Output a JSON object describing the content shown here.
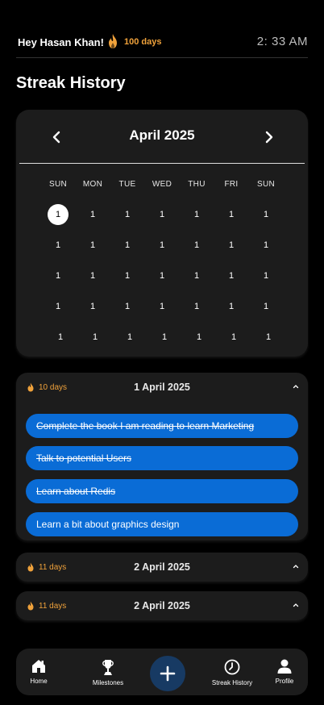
{
  "header": {
    "greeting": "Hey Hasan Khan!",
    "streak_days": "100 days",
    "time": "2: 33 AM",
    "flame_icon": "flame-icon",
    "accent_color": "#f0a23b"
  },
  "page_title": "Streak History",
  "calendar": {
    "month_label": "April 2025",
    "prev_icon": "chevron-left-icon",
    "next_icon": "chevron-right-icon",
    "weekdays": [
      "SUN",
      "MON",
      "TUE",
      "WED",
      "THU",
      "FRI",
      "SUN"
    ],
    "rows": [
      [
        "1",
        "1",
        "1",
        "1",
        "1",
        "1",
        "1"
      ],
      [
        "1",
        "1",
        "1",
        "1",
        "1",
        "1",
        "1"
      ],
      [
        "1",
        "1",
        "1",
        "1",
        "1",
        "1",
        "1"
      ],
      [
        "1",
        "1",
        "1",
        "1",
        "1",
        "1",
        "1"
      ],
      [
        "1",
        "1",
        "1",
        "1",
        "1",
        "1",
        "1"
      ]
    ],
    "selected": {
      "row": 0,
      "col": 0
    }
  },
  "streak_entries": [
    {
      "days": "10 days",
      "date": "1 April 2025",
      "expanded": true,
      "tasks": [
        {
          "label": "Complete the book I am reading to learn Marketing",
          "done": true
        },
        {
          "label": "Talk to potential Users",
          "done": true
        },
        {
          "label": "Learn about Redis",
          "done": true
        },
        {
          "label": "Learn a bit about graphics design",
          "done": false
        }
      ]
    },
    {
      "days": "11 days",
      "date": "2 April 2025",
      "expanded": false,
      "tasks": []
    },
    {
      "days": "11 days",
      "date": "2 April 2025",
      "expanded": false,
      "tasks": []
    }
  ],
  "task_color": "#0a6cd6",
  "bottom_nav": {
    "home": "Home",
    "milestones": "Milestones",
    "add_icon": "plus-icon",
    "streak_history": "Streak History",
    "profile": "Profile"
  }
}
